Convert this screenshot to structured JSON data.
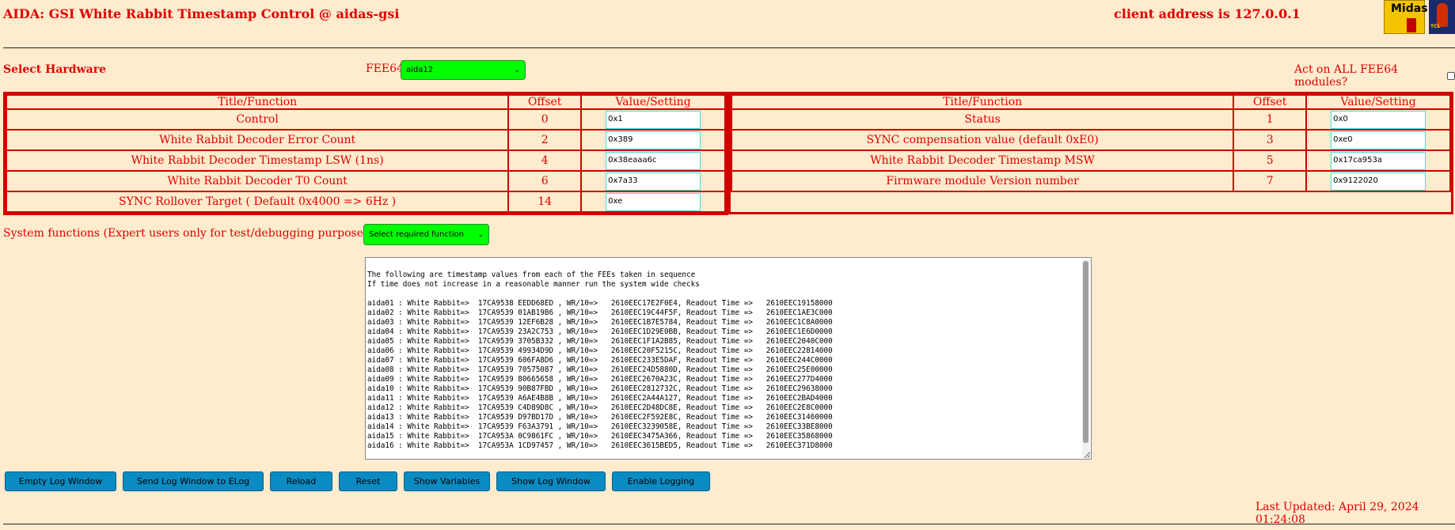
{
  "header": {
    "title": "AIDA: GSI White Rabbit Timestamp Control @ aidas-gsi",
    "client_address": "client address is 127.0.0.1",
    "logo_midas": "Midas",
    "logo_tcl": "TCL"
  },
  "hardware": {
    "label": "Select Hardware",
    "fee_label": "FEE64",
    "fee_selected": "aida12",
    "act_all_label": "Act on ALL FEE64 modules?"
  },
  "table_headers": {
    "title": "Title/Function",
    "offset": "Offset",
    "value": "Value/Setting"
  },
  "left_rows": [
    {
      "title": "Control",
      "offset": "0",
      "value": "0x1"
    },
    {
      "title": "White Rabbit Decoder Error Count",
      "offset": "2",
      "value": "0x389"
    },
    {
      "title": "White Rabbit Decoder Timestamp LSW (1ns)",
      "offset": "4",
      "value": "0x38eaaa6c"
    },
    {
      "title": "White Rabbit Decoder T0 Count",
      "offset": "6",
      "value": "0x7a33"
    },
    {
      "title": "SYNC Rollover Target ( Default 0x4000 => 6Hz )",
      "offset": "14",
      "value": "0xe"
    }
  ],
  "right_rows": [
    {
      "title": "Status",
      "offset": "1",
      "value": "0x0"
    },
    {
      "title": "SYNC compensation value (default 0xE0)",
      "offset": "3",
      "value": "0xe0"
    },
    {
      "title": "White Rabbit Decoder Timestamp MSW",
      "offset": "5",
      "value": "0x17ca953a"
    },
    {
      "title": "Firmware module Version number",
      "offset": "7",
      "value": "0x9122020"
    }
  ],
  "system": {
    "label": "System functions (Expert users only for test/debugging purposes!!!)",
    "select_placeholder": "Select required function"
  },
  "log": {
    "lines": [
      "The following are timestamp values from each of the FEEs taken in sequence",
      "If time does not increase in a reasonable manner run the system wide checks",
      "",
      "aida01 : White Rabbit=>  17CA9538 EEDD68ED , WR/10=>   2610EEC17E2F0E4, Readout Time =>   2610EEC19158000",
      "aida02 : White Rabbit=>  17CA9539 01AB19B6 , WR/10=>   2610EEC19C44F5F, Readout Time =>   2610EEC1AE3C000",
      "aida03 : White Rabbit=>  17CA9539 12EF6B28 , WR/10=>   2610EEC1B7E5784, Readout Time =>   2610EEC1C8A0000",
      "aida04 : White Rabbit=>  17CA9539 23A2C753 , WR/10=>   2610EEC1D29E0BB, Readout Time =>   2610EEC1E6D0000",
      "aida05 : White Rabbit=>  17CA9539 3705B332 , WR/10=>   2610EEC1F1A2B85, Readout Time =>   2610EEC2040C000",
      "aida06 : White Rabbit=>  17CA9539 49934D9D , WR/10=>   2610EEC20F5215C, Readout Time =>   2610EEC22814000",
      "aida07 : White Rabbit=>  17CA9539 606FA8D6 , WR/10=>   2610EEC233E5DAF, Readout Time =>   2610EEC244C0000",
      "aida08 : White Rabbit=>  17CA9539 70575087 , WR/10=>   2610EEC24D5880D, Readout Time =>   2610EEC25E00000",
      "aida09 : White Rabbit=>  17CA9539 80665658 , WR/10=>   2610EEC2670A23C, Readout Time =>   2610EEC277D4000",
      "aida10 : White Rabbit=>  17CA9539 90B87FBD , WR/10=>   2610EEC2812732C, Readout Time =>   2610EEC29638000",
      "aida11 : White Rabbit=>  17CA9539 A6AE4B8B , WR/10=>   2610EEC2A44A127, Readout Time =>   2610EEC2BAD4000",
      "aida12 : White Rabbit=>  17CA9539 C4D89D8C , WR/10=>   2610EEC2D48DC8E, Readout Time =>   2610EEC2E8C0000",
      "aida13 : White Rabbit=>  17CA9539 D97BD17D , WR/10=>   2610EEC2F592E8C, Readout Time =>   2610EEC31460000",
      "aida14 : White Rabbit=>  17CA9539 F63A3791 , WR/10=>   2610EEC3239058E, Readout Time =>   2610EEC33BE8000",
      "aida15 : White Rabbit=>  17CA953A 0C9861FC , WR/10=>   2610EEC3475A366, Readout Time =>   2610EEC35868000",
      "aida16 : White Rabbit=>  17CA953A 1CD97457 , WR/10=>   2610EEC3615BED5, Readout Time =>   2610EEC371D8000"
    ]
  },
  "buttons": [
    {
      "name": "empty-log-window-button",
      "label": "Empty Log Window",
      "width": 141
    },
    {
      "name": "send-log-to-elog-button",
      "label": "Send Log Window to ELog",
      "width": 178
    },
    {
      "name": "reload-button",
      "label": "Reload",
      "width": 79
    },
    {
      "name": "reset-button",
      "label": "Reset",
      "width": 74
    },
    {
      "name": "show-variables-button",
      "label": "Show Variables",
      "width": 109
    },
    {
      "name": "show-log-window-button",
      "label": "Show Log Window",
      "width": 138
    },
    {
      "name": "enable-logging-button",
      "label": "Enable Logging",
      "width": 124
    }
  ],
  "footer": {
    "last_updated": "Last Updated: April 29, 2024 01:24:08"
  }
}
